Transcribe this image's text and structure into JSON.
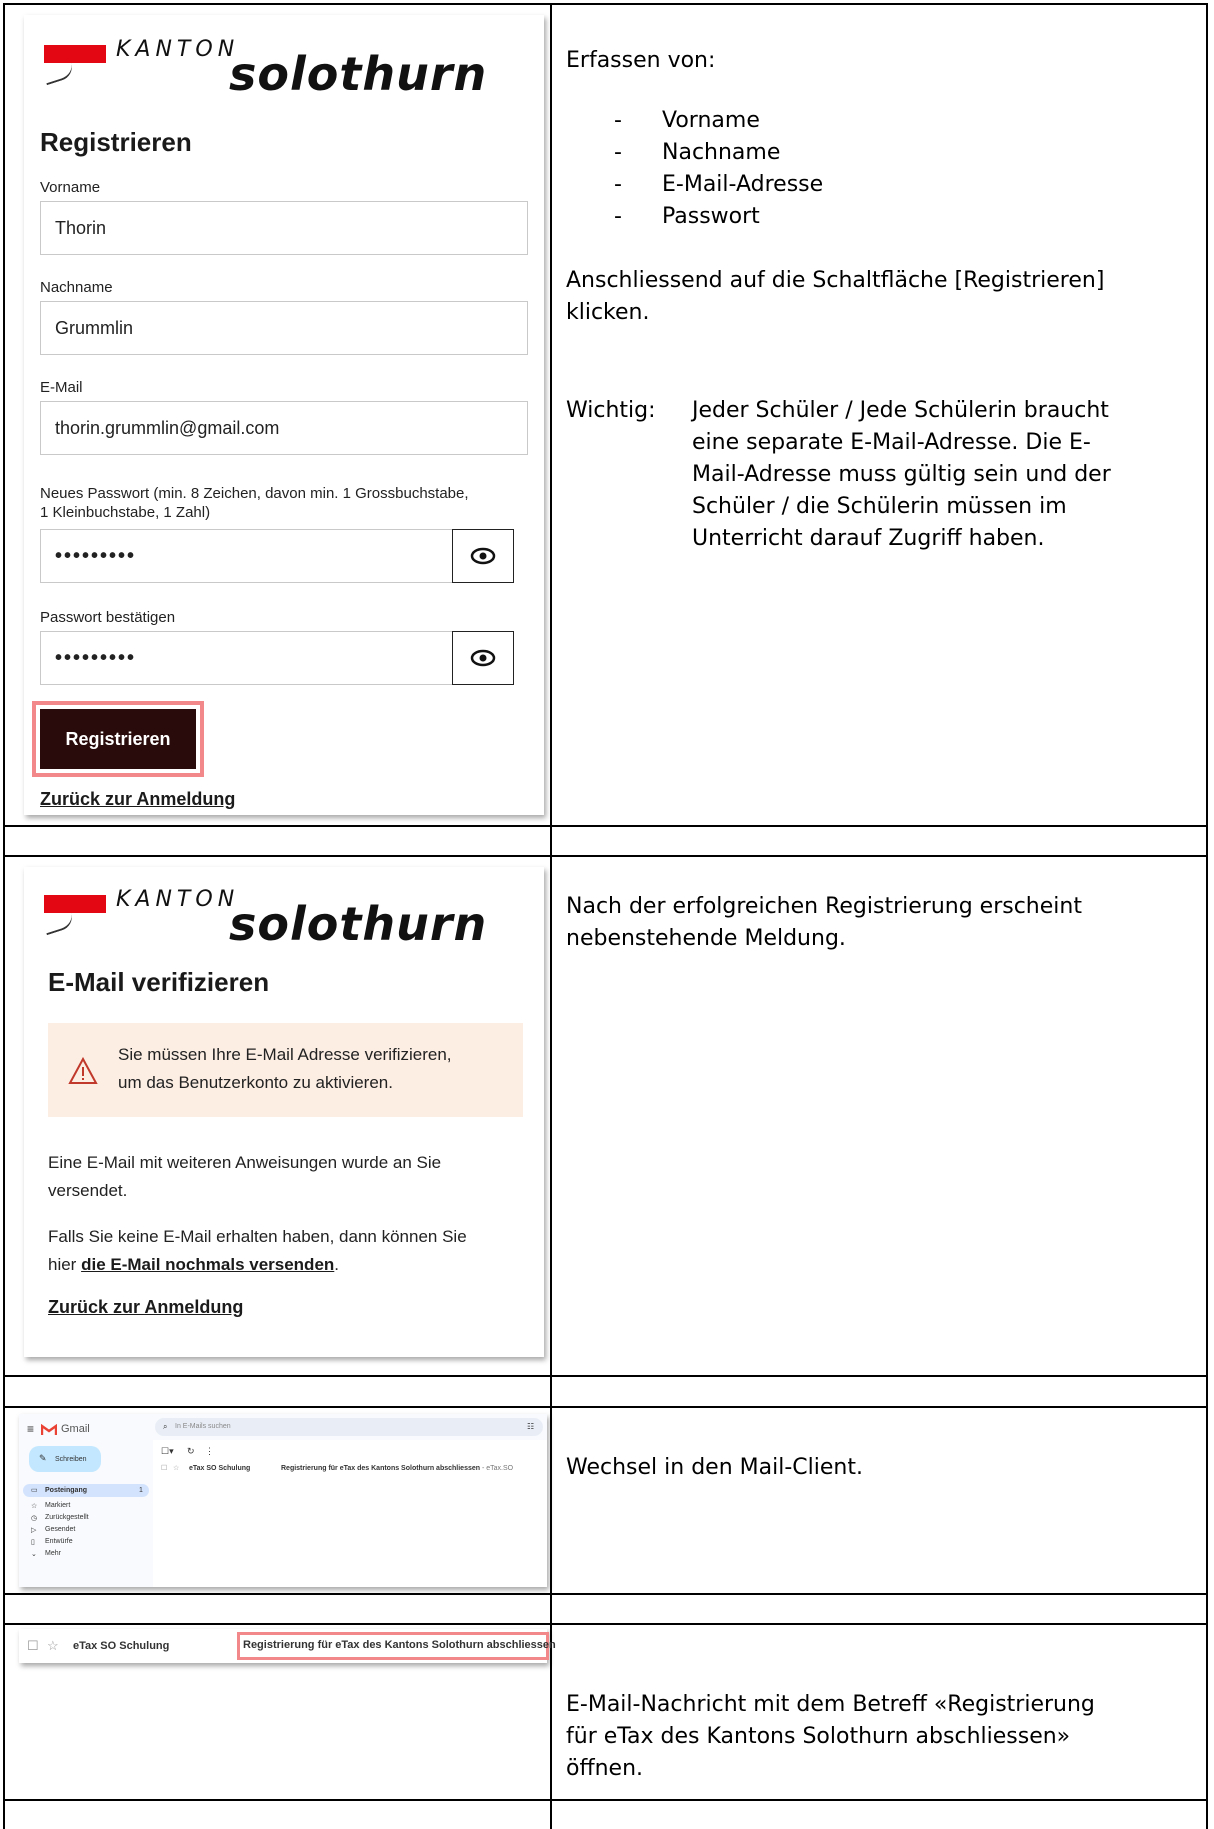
{
  "section1": {
    "kanton": "KANTON",
    "brand": "solothurn",
    "title": "Registrieren",
    "fields": [
      {
        "label": "Vorname",
        "value": "Thorin"
      },
      {
        "label": "Nachname",
        "value": "Grummlin"
      },
      {
        "label": "E-Mail",
        "value": "thorin.grummlin@gmail.com"
      }
    ],
    "password_label_1": "Neues Passwort (min. 8 Zeichen, davon min. 1 Grossbuchstabe,",
    "password_label_2": "1 Kleinbuchstabe, 1 Zahl)",
    "password_value": "•••••••••",
    "confirm_label": "Passwort bestätigen",
    "confirm_value": "•••••••••",
    "button": "Registrieren",
    "back_link": "Zurück zur Anmeldung",
    "instr_intro": "Erfassen von:",
    "instr_items": [
      "Vorname",
      "Nachname",
      "E-Mail-Adresse",
      "Passwort"
    ],
    "instr_click_1": "Anschliessend auf die Schaltfläche [Registrieren]",
    "instr_click_2": "klicken.",
    "important_label": "Wichtig:",
    "important_lines": [
      "Jeder Schüler / Jede Schülerin braucht",
      "eine separate E-Mail-Adresse. Die E-",
      "Mail-Adresse muss gültig sein und der",
      "Schüler / die Schülerin müssen im",
      "Unterricht darauf Zugriff haben."
    ]
  },
  "section2": {
    "kanton": "KANTON",
    "brand": "solothurn",
    "title": "E-Mail verifizieren",
    "notice_1": "Sie müssen Ihre E-Mail Adresse verifizieren,",
    "notice_2": "um das Benutzerkonto zu aktivieren.",
    "p1_1": "Eine E-Mail mit weiteren Anweisungen wurde an Sie",
    "p1_2": "versendet.",
    "p2_1": "Falls Sie keine E-Mail erhalten haben, dann können Sie",
    "p2_2a": "hier",
    "p2_link": "die E-Mail nochmals versenden",
    "p2_2b": ".",
    "back_link": "Zurück zur Anmeldung",
    "instr_1": "Nach der erfolgreichen Registrierung erscheint",
    "instr_2": "nebenstehende Meldung."
  },
  "section3": {
    "app": "Gmail",
    "search": "In E-Mails suchen",
    "compose": "Schreiben",
    "nav": [
      "Posteingang",
      "Markiert",
      "Zurückgestellt",
      "Gesendet",
      "Entwürfe",
      "Mehr"
    ],
    "inbox_count": "1",
    "sender": "eTax SO Schulung",
    "subject": "Registrierung für eTax des Kantons Solothurn abschliessen",
    "snippet": " - eTax.SO",
    "instr": "Wechsel in den Mail-Client."
  },
  "section4": {
    "sender": "eTax SO Schulung",
    "subject": "Registrierung für eTax des Kantons Solothurn abschliessen",
    "instr_1": "E-Mail-Nachricht mit dem Betreff «Registrierung",
    "instr_2": "für eTax des Kantons Solothurn abschliessen»",
    "instr_3": "öffnen."
  },
  "colors": {
    "accent": "#e30613",
    "button": "#2a0b0b",
    "highlight": "#f2888a",
    "notice": "#fdeee4"
  }
}
